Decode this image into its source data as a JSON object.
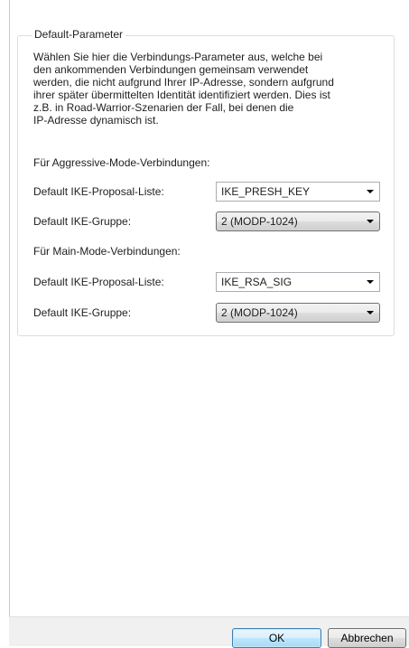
{
  "group": {
    "title": "Default-Parameter",
    "description": "Wählen Sie hier die Verbindungs-Parameter aus, welche bei\nden ankommenden Verbindungen gemeinsam verwendet\nwerden, die nicht aufgrund Ihrer IP-Adresse, sondern aufgrund\nihrer später übermittelten Identität identifiziert werden. Dies ist\nz.B. in Road-Warrior-Szenarien der Fall, bei denen die\nIP-Adresse dynamisch ist."
  },
  "aggressive": {
    "heading": "Für Aggressive-Mode-Verbindungen:",
    "proposal_label": "Default IKE-Proposal-Liste:",
    "proposal_value": "IKE_PRESH_KEY",
    "group_label": "Default IKE-Gruppe:",
    "group_value": "2 (MODP-1024)"
  },
  "main": {
    "heading": "Für Main-Mode-Verbindungen:",
    "proposal_label": "Default IKE-Proposal-Liste:",
    "proposal_value": "IKE_RSA_SIG",
    "group_label": "Default IKE-Gruppe:",
    "group_value": "2 (MODP-1024)"
  },
  "buttons": {
    "ok": "OK",
    "cancel": "Abbrechen"
  },
  "icons": {
    "dropdown": "chevron-down-icon"
  }
}
